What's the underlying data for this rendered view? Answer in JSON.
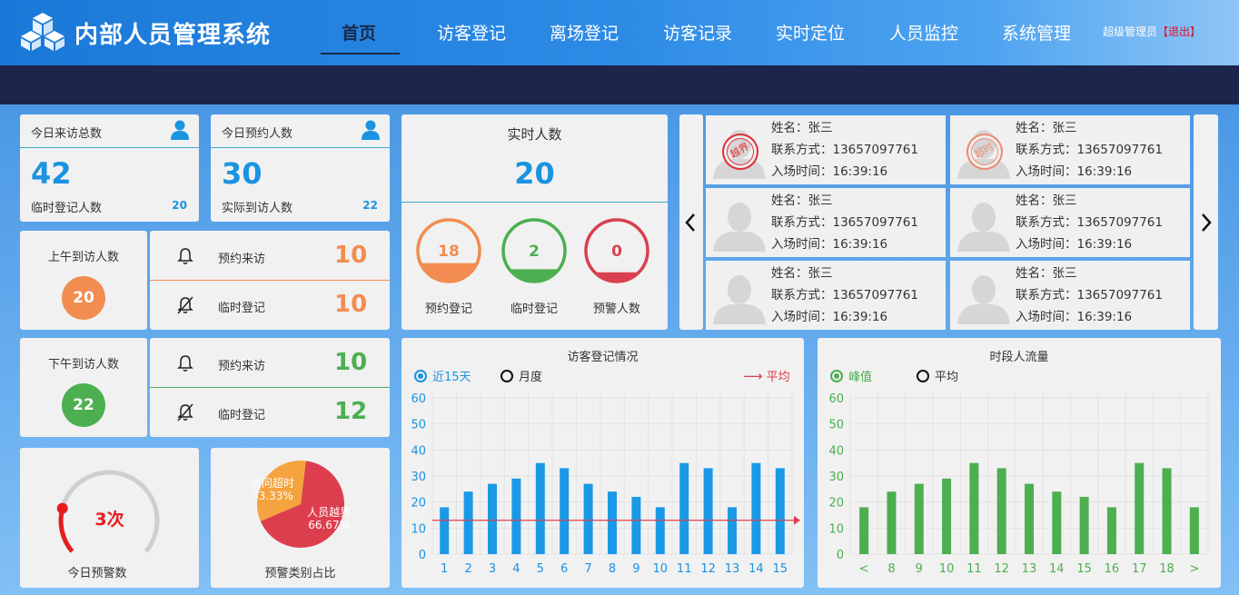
{
  "header": {
    "title": "内部人员管理系统",
    "nav": [
      "首页",
      "访客登记",
      "离场登记",
      "访客记录",
      "实时定位",
      "人员监控",
      "系统管理"
    ],
    "user": "超级管理员",
    "logout": "【退出】"
  },
  "today_total": {
    "title": "今日来访总数",
    "value": "42",
    "sub_label": "临时登记人数",
    "sub_value": "20"
  },
  "today_reserved": {
    "title": "今日预约人数",
    "value": "30",
    "sub_label": "实际到访人数",
    "sub_value": "22"
  },
  "realtime": {
    "title": "实时人数",
    "value": "20",
    "rings": [
      {
        "value": "18",
        "label": "预约登记",
        "color": "#f28c50",
        "fill": 0.3
      },
      {
        "value": "2",
        "label": "临时登记",
        "color": "#4caf50",
        "fill": 0.2
      },
      {
        "value": "0",
        "label": "预警人数",
        "color": "#d94050",
        "fill": 0.15
      }
    ]
  },
  "morning": {
    "title": "上午到访人数",
    "value": "20",
    "color": "#f28c50",
    "rows": [
      {
        "label": "预约来访",
        "value": "10"
      },
      {
        "label": "临时登记",
        "value": "10"
      }
    ]
  },
  "afternoon": {
    "title": "下午到访人数",
    "value": "22",
    "color": "#4caf50",
    "rows": [
      {
        "label": "预约来访",
        "value": "10"
      },
      {
        "label": "临时登记",
        "value": "12"
      }
    ]
  },
  "people": [
    {
      "name": "姓名：张三",
      "phone": "联系方式：13657097761",
      "time": "入场时间：16:39:16",
      "stamp": "越界"
    },
    {
      "name": "姓名：张三",
      "phone": "联系方式：13657097761",
      "time": "入场时间：16:39:16",
      "stamp": "超时"
    },
    {
      "name": "姓名：张三",
      "phone": "联系方式：13657097761",
      "time": "入场时间：16:39:16",
      "stamp": ""
    },
    {
      "name": "姓名：张三",
      "phone": "联系方式：13657097761",
      "time": "入场时间：16:39:16",
      "stamp": ""
    },
    {
      "name": "姓名：张三",
      "phone": "联系方式：13657097761",
      "time": "入场时间：16:39:16",
      "stamp": ""
    },
    {
      "name": "姓名：张三",
      "phone": "联系方式：13657097761",
      "time": "入场时间：16:39:16",
      "stamp": ""
    }
  ],
  "warning_gauge": {
    "value": "3次",
    "label": "今日预警数",
    "fraction": 0.12
  },
  "warning_pie": {
    "label": "预警类别占比",
    "slices": [
      {
        "name": "人员越界",
        "pct": "66.67%",
        "value": 66.67,
        "color": "#dd3e4e"
      },
      {
        "name": "访问超时",
        "pct": "33.33%",
        "value": 33.33,
        "color": "#f4a33e"
      }
    ]
  },
  "chart_data": [
    {
      "type": "bar",
      "title": "访客登记情况",
      "legend": [
        "近15天",
        "月度"
      ],
      "avg_label": "平均",
      "categories": [
        "1",
        "2",
        "3",
        "4",
        "5",
        "6",
        "7",
        "8",
        "9",
        "10",
        "11",
        "12",
        "13",
        "14",
        "15"
      ],
      "values": [
        18,
        24,
        27,
        29,
        35,
        33,
        27,
        24,
        22,
        18,
        35,
        33,
        18,
        35,
        33
      ],
      "average": 13,
      "ylim": [
        0,
        60
      ],
      "yticks": [
        "0",
        "10",
        "20",
        "30",
        "40",
        "50",
        "60"
      ],
      "color": "#1a9ae6"
    },
    {
      "type": "bar",
      "title": "时段人流量",
      "legend": [
        "峰值",
        "平均"
      ],
      "categories": [
        "<",
        "8",
        "9",
        "10",
        "11",
        "12",
        "13",
        "14",
        "15",
        "16",
        "17",
        "18",
        ">"
      ],
      "values": [
        18,
        24,
        27,
        29,
        35,
        33,
        27,
        24,
        22,
        18,
        35,
        33,
        18
      ],
      "ylim": [
        0,
        60
      ],
      "yticks": [
        "0",
        "10",
        "20",
        "30",
        "40",
        "50",
        "60"
      ],
      "color": "#4caf50"
    }
  ]
}
